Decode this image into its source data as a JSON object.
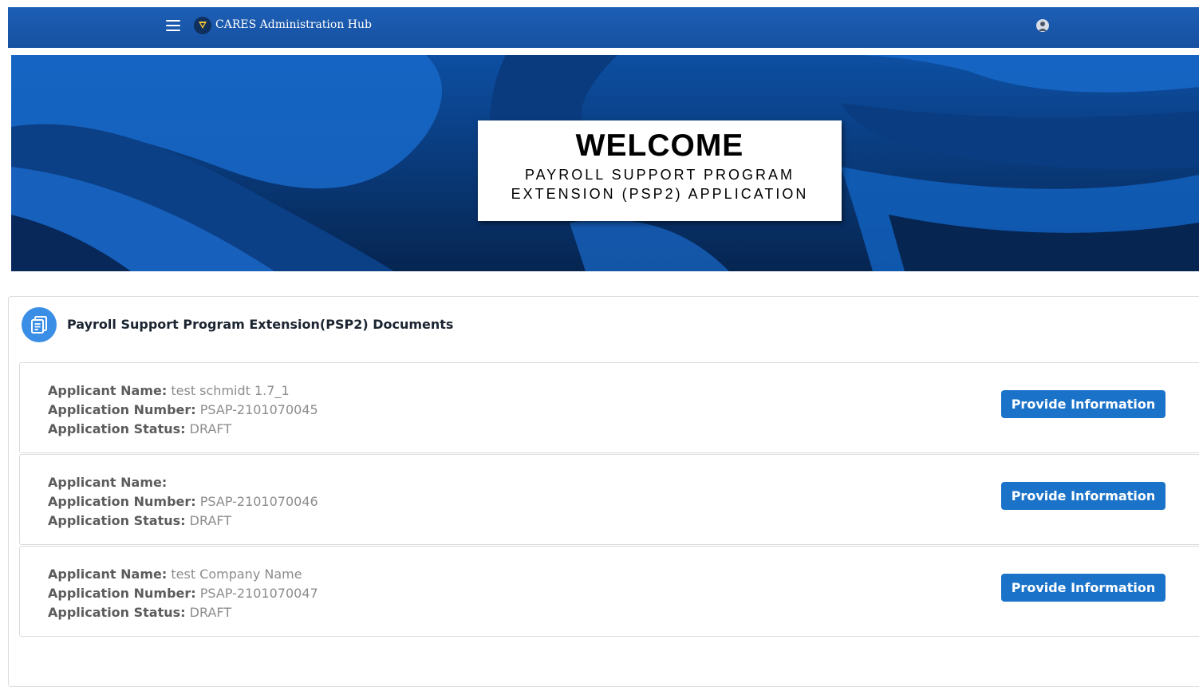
{
  "header": {
    "app_title": "CARES Administration Hub",
    "menu_icon": "hamburger-icon",
    "logo_icon": "shield-logo-icon",
    "user_icon": "user-avatar-icon",
    "bg_color": "#1650a0"
  },
  "banner": {
    "title": "WELCOME",
    "subtitle_line1": "PAYROLL SUPPORT PROGRAM",
    "subtitle_line2": "EXTENSION (PSP2) APPLICATION"
  },
  "documents": {
    "title": "Payroll Support Program Extension(PSP2) Documents",
    "icon": "documents-icon",
    "labels": {
      "applicant_name": "Applicant Name:",
      "application_number": "Application Number:",
      "application_status": "Application Status:"
    },
    "rows": [
      {
        "applicant_name": "test schmidt 1.7_1",
        "application_number": "PSAP-2101070045",
        "application_status": "DRAFT",
        "button_label": "Provide Information"
      },
      {
        "applicant_name": "",
        "application_number": "PSAP-2101070046",
        "application_status": "DRAFT",
        "button_label": "Provide Information"
      },
      {
        "applicant_name": "test Company Name",
        "application_number": "PSAP-2101070047",
        "application_status": "DRAFT",
        "button_label": "Provide Information"
      }
    ]
  },
  "colors": {
    "accent": "#1a73c9",
    "banner_dark": "#0a3c82"
  }
}
